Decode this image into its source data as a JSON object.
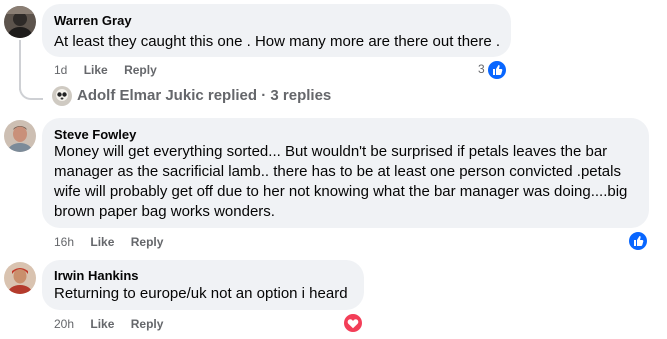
{
  "comments": [
    {
      "author": "Warren Gray",
      "text": "At least they caught this one . How many more are there out there .",
      "time": "1d",
      "like": "Like",
      "reply": "Reply",
      "reaction_count": "3",
      "reaction": "like"
    },
    {
      "author": "Steve Fowley",
      "text": "Money will get everything sorted... But wouldn't be surprised if petals leaves the bar manager as the sacrificial lamb.. there has to be at least one person convicted .petals wife will probably get off due to her not knowing what the bar manager was doing....big brown paper bag works wonders.",
      "time": "16h",
      "like": "Like",
      "reply": "Reply",
      "reaction": "like"
    },
    {
      "author": "Irwin Hankins",
      "text": "Returning to europe/uk not an option i heard",
      "time": "20h",
      "like": "Like",
      "reply": "Reply",
      "reaction": "love"
    }
  ],
  "replies_summary": {
    "text": "Adolf Elmar Jukic replied · 3 replies"
  },
  "colors": {
    "like_blue": "#0866ff",
    "love_red": "#f33e58",
    "bubble": "#f0f2f5",
    "meta_gray": "#65676b"
  }
}
